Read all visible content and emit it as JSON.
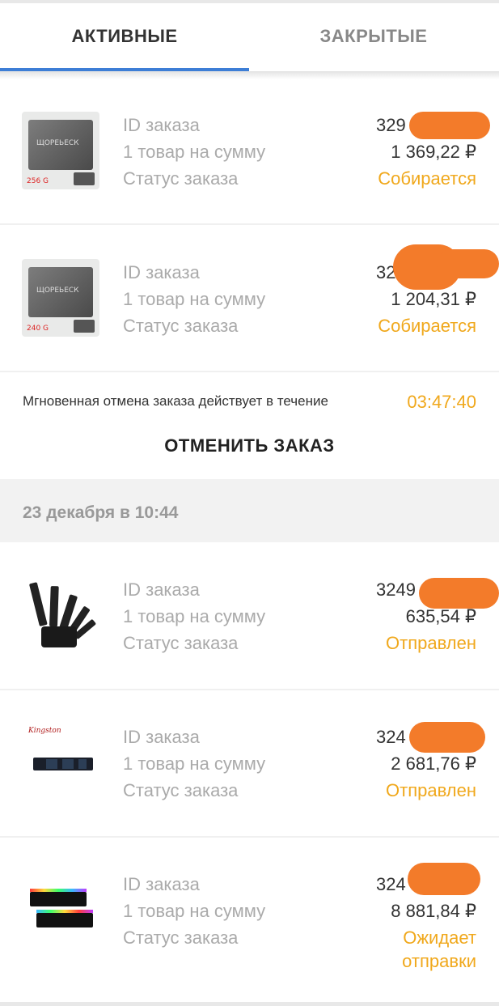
{
  "tabs": {
    "active": "АКТИВНЫЕ",
    "closed": "ЗАКРЫТЫЕ"
  },
  "labels": {
    "order_id": "ID заказа",
    "items_sum": "1 товар на сумму",
    "order_status": "Статус заказа"
  },
  "orders_group1": [
    {
      "thumb_icon": "ssd-icon",
      "ssd_brand": "ЩОРЕЬЕСК",
      "ssd_capacity": "256 G",
      "id_visible": "329",
      "sum": "1 369,22 ₽",
      "status": "Собирается"
    },
    {
      "thumb_icon": "ssd-icon",
      "ssd_brand": "ЩОРЕЬЕСК",
      "ssd_capacity": "240 G",
      "id_visible": "329",
      "sum": "1 204,31 ₽",
      "status": "Собирается"
    }
  ],
  "cancel": {
    "text": "Мгновенная отмена заказа действует в течение",
    "timer": "03:47:40",
    "button": "ОТМЕНИТЬ ЗАКАЗ"
  },
  "date_header": "23 декабря в 10:44",
  "orders_group2": [
    {
      "thumb_icon": "knife-set-icon",
      "id_visible": "3249",
      "sum": "635,54 ₽",
      "status": "Отправлен"
    },
    {
      "thumb_icon": "m2-ssd-icon",
      "brand_logo": "Kingston",
      "id_visible": "324",
      "sum": "2 681,76 ₽",
      "status": "Отправлен"
    },
    {
      "thumb_icon": "ram-modules-icon",
      "id_visible": "324",
      "sum": "8 881,84 ₽",
      "status_line1": "Ожидает",
      "status_line2": "отправки"
    }
  ],
  "colors": {
    "accent_blue": "#3d7ed6",
    "status_orange": "#f0a81c",
    "redaction": "#f37b2a"
  }
}
